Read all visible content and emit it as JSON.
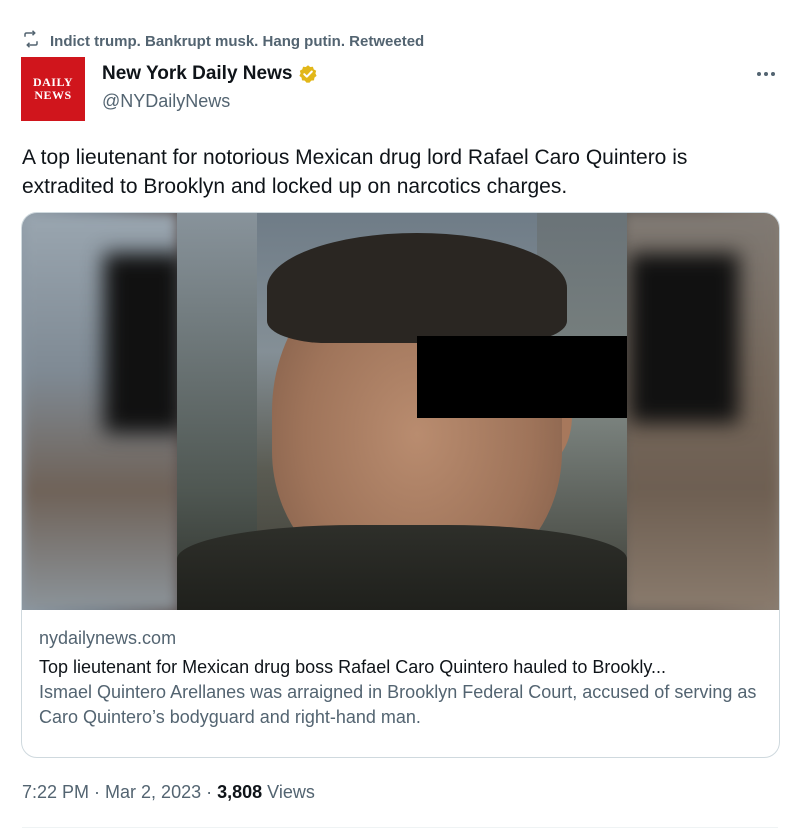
{
  "retweet": {
    "label": "Indict trump. Bankrupt musk. Hang putin. Retweeted"
  },
  "author": {
    "avatar_line1": "DAILY",
    "avatar_line2": "NEWS",
    "display_name": "New York Daily News",
    "handle": "@NYDailyNews",
    "verified_color": "#e2b719"
  },
  "tweet": {
    "text": "A top lieutenant for notorious Mexican drug lord Rafael Caro Quintero is extradited to Brooklyn and locked up on narcotics charges."
  },
  "card": {
    "domain": "nydailynews.com",
    "title": "Top lieutenant for Mexican drug boss Rafael Caro Quintero hauled to Brookly...",
    "description": "Ismael Quintero Arellanes was arraigned in Brooklyn Federal Court, accused of serving as Caro Quintero’s bodyguard and right-hand man."
  },
  "meta": {
    "time": "7:22 PM",
    "separator": "·",
    "date": "Mar 2, 2023",
    "views_count": "3,808",
    "views_label": "Views"
  },
  "colors": {
    "brand_red": "#d0151c",
    "muted_text": "#536471",
    "border": "#cfd9de"
  },
  "icons": {
    "retweet": "retweet-icon",
    "verified": "verified-badge-icon",
    "more": "more-options-icon"
  }
}
